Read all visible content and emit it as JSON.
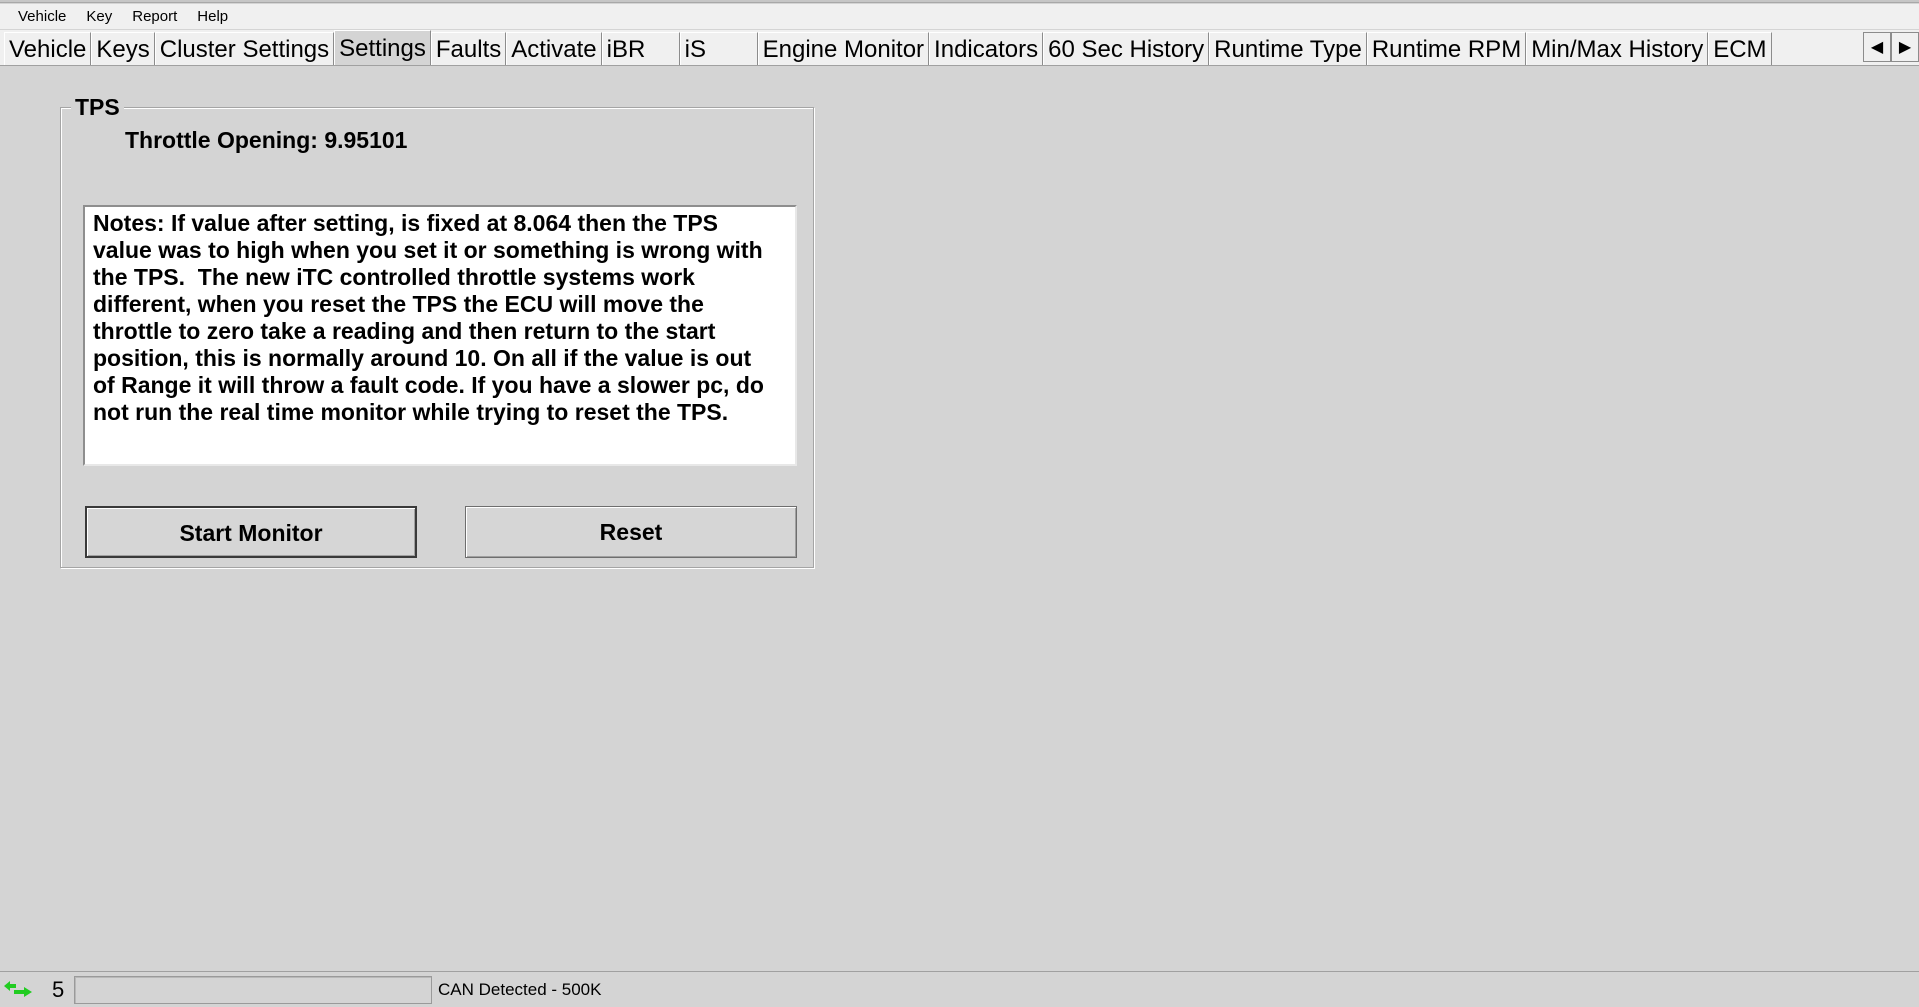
{
  "menu": {
    "items": [
      "Vehicle",
      "Key",
      "Report",
      "Help"
    ]
  },
  "tabs": [
    {
      "label": "Vehicle"
    },
    {
      "label": "Keys"
    },
    {
      "label": "Cluster Settings"
    },
    {
      "label": "Settings",
      "active": true
    },
    {
      "label": "Faults"
    },
    {
      "label": "Activate"
    },
    {
      "label": "iBR"
    },
    {
      "label": "iS"
    },
    {
      "label": "Engine Monitor"
    },
    {
      "label": "Indicators"
    },
    {
      "label": "60 Sec History"
    },
    {
      "label": "Runtime Type"
    },
    {
      "label": "Runtime RPM"
    },
    {
      "label": "Min/Max History"
    },
    {
      "label": "ECM"
    }
  ],
  "tab_scroll": {
    "left_glyph": "◀",
    "right_glyph": "▶"
  },
  "tps": {
    "group_title": "TPS",
    "throttle_label": "Throttle Opening:",
    "throttle_value": "9.95101",
    "notes": "Notes: If value after setting, is fixed at 8.064 then the TPS\nvalue was to high when you set it or something is wrong with\nthe TPS.  The new iTC controlled throttle systems work\ndifferent, when you reset the TPS the ECU will move the\nthrottle to zero take a reading and then return to the start\nposition, this is normally around 10. On all if the value is out\nof Range it will throw a fault code. If you have a slower pc, do\nnot run the real time monitor while trying to reset the TPS.",
    "start_monitor_label": "Start Monitor",
    "reset_label": "Reset"
  },
  "status": {
    "icon": "green-arrows-icon",
    "count": "5",
    "field_value": "",
    "text": "CAN Detected - 500K"
  },
  "colors": {
    "background": "#d4d4d4",
    "status_icon": "#22cc22"
  }
}
